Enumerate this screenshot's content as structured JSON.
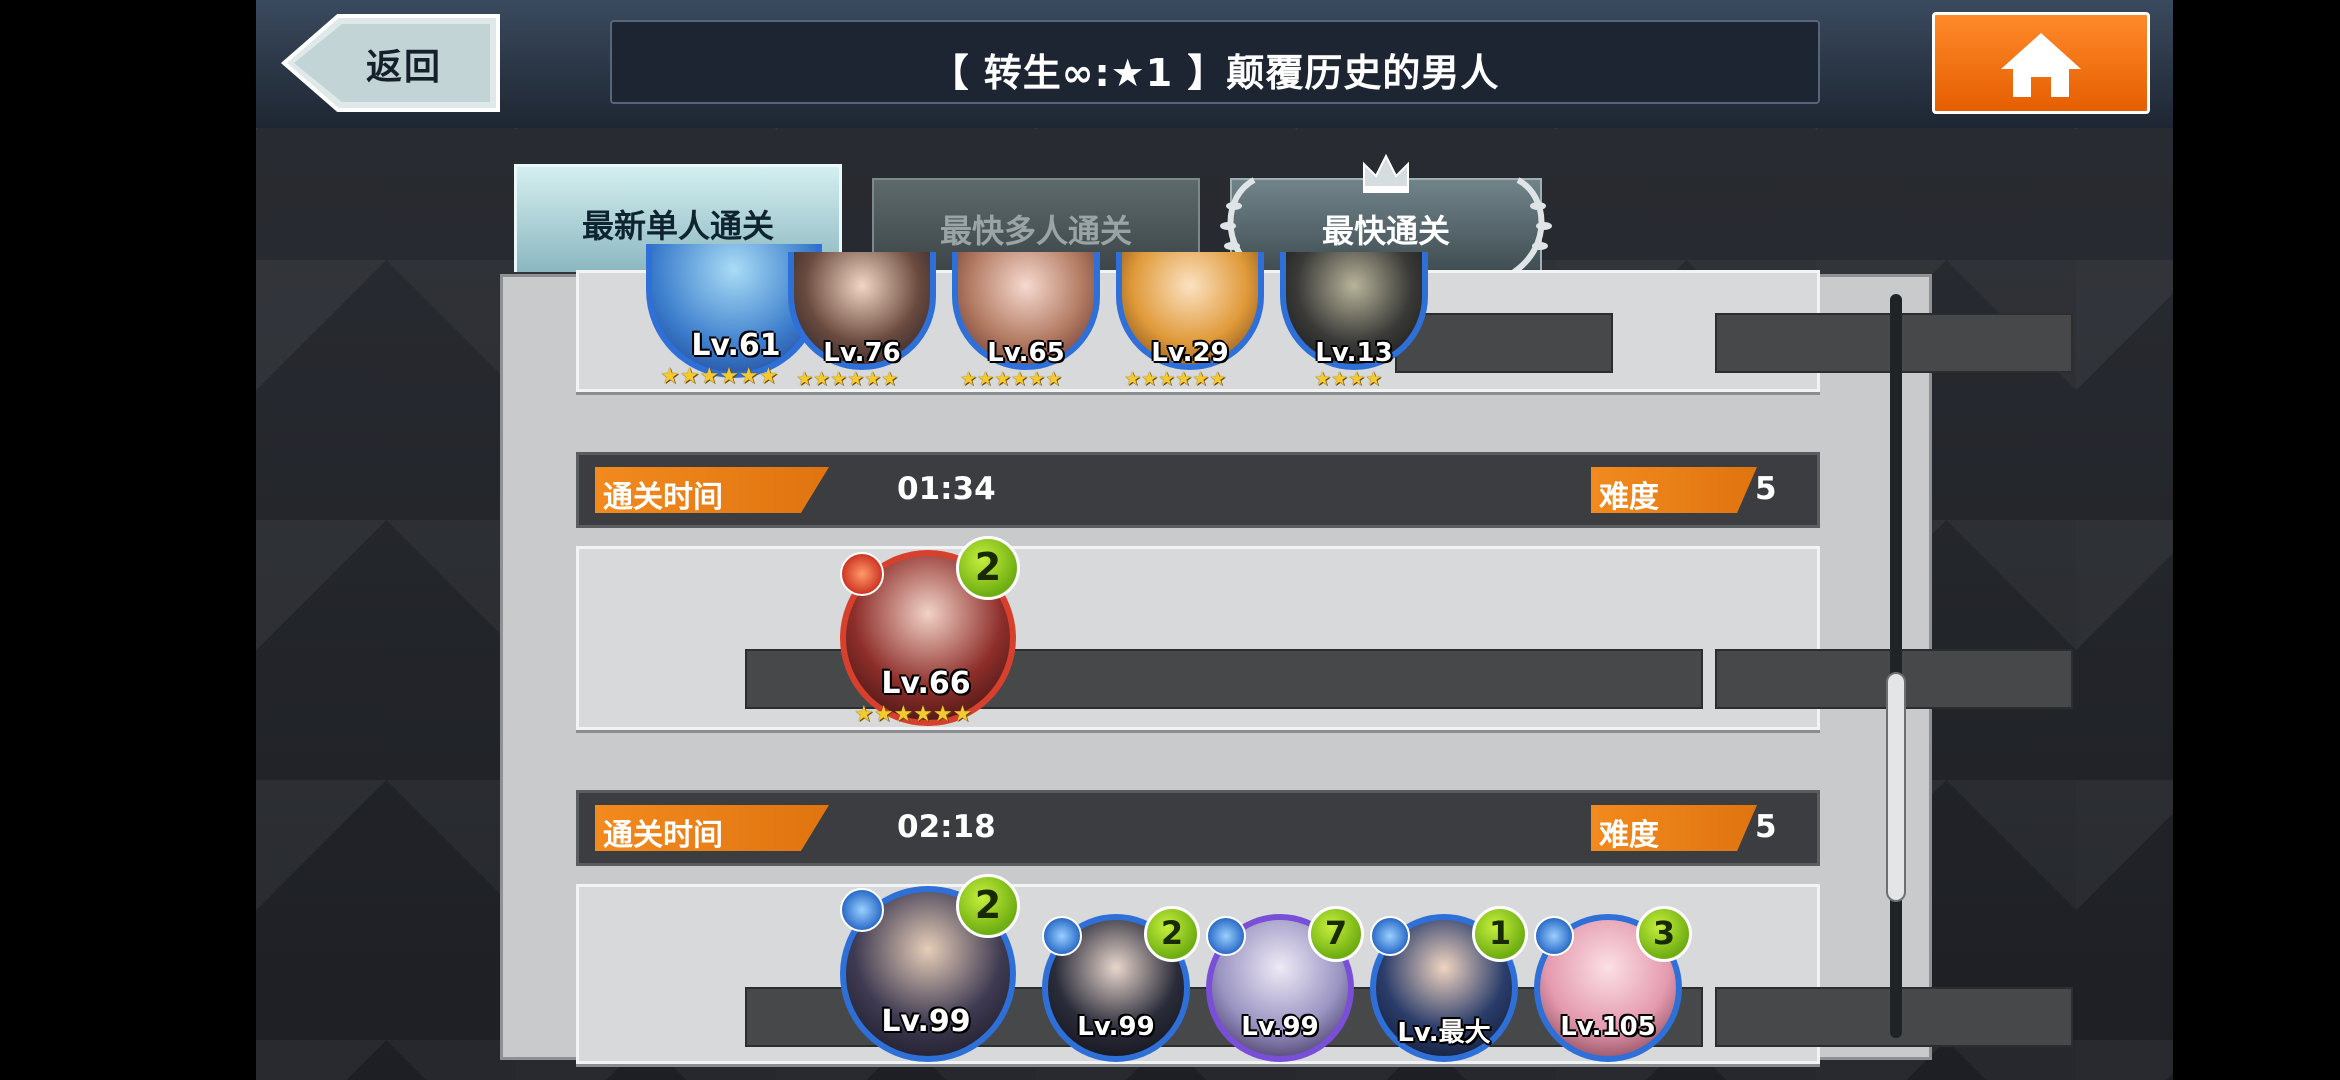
{
  "header": {
    "back_label": "返回",
    "title": "【 转生∞:★1 】颠覆历史的男人",
    "home_icon": "home-icon"
  },
  "tabs": [
    {
      "label": "最新单人通关",
      "state": "active"
    },
    {
      "label": "最快多人通关",
      "state": "inactive"
    },
    {
      "label": "最快通关",
      "state": "inactive",
      "decoration": "crown-laurel-icon"
    }
  ],
  "records": [
    {
      "time_label": "通关时间",
      "time": "",
      "difficulty_label": "难度",
      "difficulty": "",
      "party": [
        {
          "level": "Lv.61",
          "stars": "★★★★★★",
          "frame": "blue"
        },
        {
          "level": "Lv.76",
          "stars": "★★★★★★",
          "frame": "blue"
        },
        {
          "level": "Lv.65",
          "stars": "★★★★★★",
          "frame": "blue"
        },
        {
          "level": "Lv.29",
          "stars": "★★★★★★",
          "frame": "blue"
        },
        {
          "level": "Lv.13",
          "stars": "★★★★",
          "frame": "blue"
        }
      ]
    },
    {
      "time_label": "通关时间",
      "time": "01:34",
      "difficulty_label": "难度",
      "difficulty": "5",
      "party": [
        {
          "level": "Lv.66",
          "stars": "★★★★★★",
          "frame": "red",
          "badge": "2",
          "element": "fire-icon"
        }
      ]
    },
    {
      "time_label": "通关时间",
      "time": "02:18",
      "difficulty_label": "难度",
      "difficulty": "5",
      "party": [
        {
          "level": "Lv.99",
          "frame": "blue",
          "badge": "2",
          "element": "water-icon"
        },
        {
          "level": "Lv.99",
          "frame": "blue",
          "badge": "2",
          "element": "water-icon"
        },
        {
          "level": "Lv.99",
          "frame": "purple",
          "badge": "7",
          "element": "water-icon"
        },
        {
          "level": "Lv.最大",
          "frame": "blue",
          "badge": "1",
          "element": "water-icon"
        },
        {
          "level": "Lv.105",
          "frame": "blue",
          "badge": "3",
          "element": "water-icon"
        }
      ]
    }
  ],
  "colors": {
    "accent_orange": "#f28a1e",
    "home_orange": "#ff7a12",
    "badge_green": "#8cc61a",
    "frame_blue": "#2e6fd8",
    "frame_red": "#d8402e",
    "frame_purple": "#7a4fd8"
  }
}
